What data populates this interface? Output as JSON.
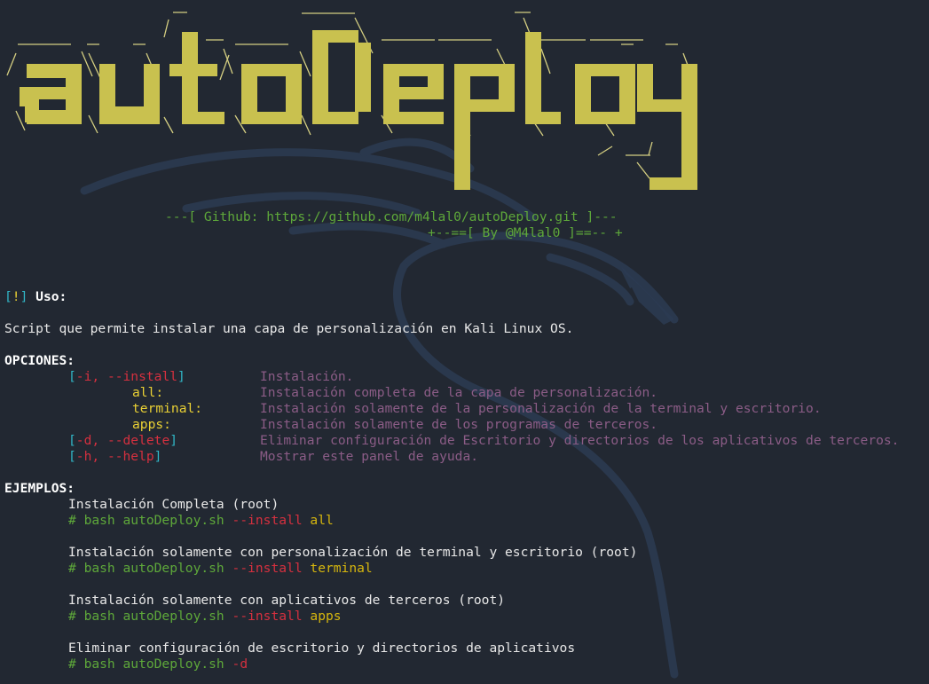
{
  "banner": {
    "title": "autoDeploy",
    "github_line": "---[ Github: https://github.com/m4lal0/autoDeploy.git ]---",
    "author_line": "+--==[ By @M4lal0 ]==-- +"
  },
  "usage": {
    "bracket_open": "[",
    "bang": "!",
    "bracket_close": "]",
    "label": " Uso:",
    "description": "Script que permite instalar una capa de personalización en Kali Linux OS."
  },
  "options": {
    "heading": "OPCIONES:",
    "install_flag": {
      "open": "[",
      "text": "-i, --install",
      "close": "]"
    },
    "install_desc": "Instalación.",
    "all_label": "all:",
    "all_desc": "Instalación completa de la capa de personalización.",
    "terminal_label": "terminal:",
    "terminal_desc": "Instalación solamente de la personalización de la terminal y escritorio.",
    "apps_label": "apps:",
    "apps_desc": "Instalación solamente de los programas de terceros.",
    "delete_flag": {
      "open": "[",
      "text": "-d, --delete",
      "close": "]"
    },
    "delete_desc": "Eliminar configuración de Escritorio y directorios de los aplicativos de terceros.",
    "help_flag": {
      "open": "[",
      "text": "-h, --help",
      "close": "]"
    },
    "help_desc": "Mostrar este panel de ayuda."
  },
  "examples": {
    "heading": "EJEMPLOS:",
    "items": [
      {
        "title": "Instalación Completa (root)",
        "cmd": "# bash autoDeploy.sh",
        "flag": "--install",
        "arg": "all"
      },
      {
        "title": "Instalación solamente con personalización de terminal y escritorio (root)",
        "cmd": "# bash autoDeploy.sh",
        "flag": "--install",
        "arg": "terminal"
      },
      {
        "title": "Instalación solamente con aplicativos de terceros (root)",
        "cmd": "# bash autoDeploy.sh",
        "flag": "--install",
        "arg": "apps"
      },
      {
        "title": "Eliminar configuración de escritorio y directorios de aplicativos",
        "cmd": "# bash autoDeploy.sh",
        "flag": "-d",
        "arg": ""
      }
    ]
  },
  "colors": {
    "background": "#222832",
    "banner_yellow": "#c9c14f",
    "accent_green": "#5ea83a",
    "accent_cyan": "#31b6c6",
    "flag_red": "#d5303f",
    "desc_mauve": "#8b5c86",
    "arg_gold": "#d6b60e"
  }
}
